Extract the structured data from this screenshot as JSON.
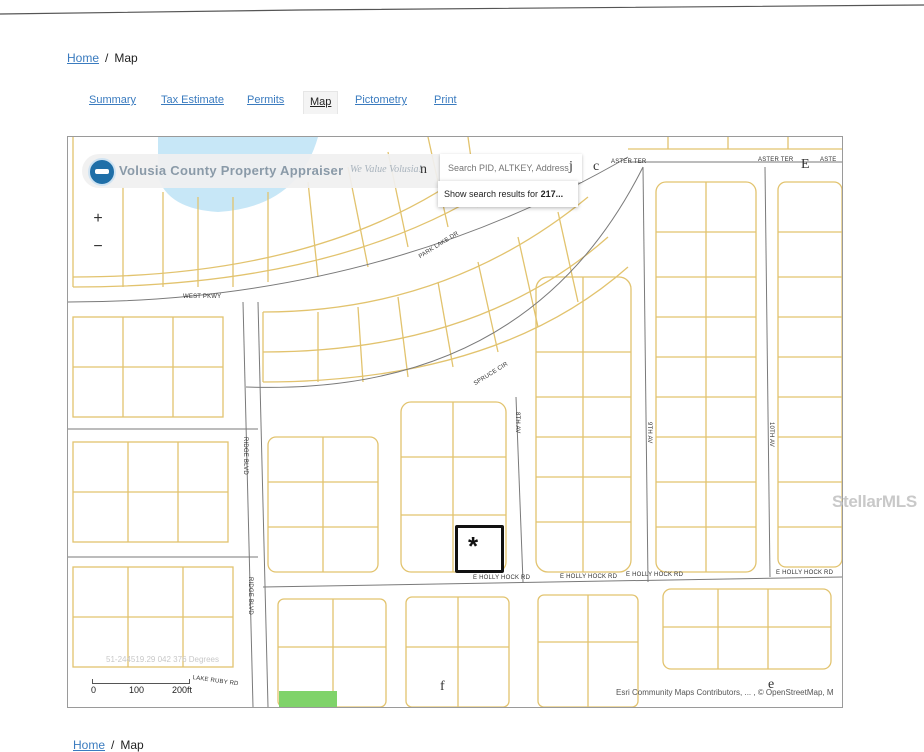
{
  "breadcrumb": {
    "home": "Home",
    "separator": "/",
    "current": "Map"
  },
  "tabs": [
    {
      "label": "Summary",
      "active": false
    },
    {
      "label": "Tax Estimate",
      "active": false
    },
    {
      "label": "Permits",
      "active": false
    },
    {
      "label": "Map",
      "active": true
    },
    {
      "label": "Pictometry",
      "active": false
    },
    {
      "label": "Print",
      "active": false
    }
  ],
  "map": {
    "org_name": "Volusia County Property Appraiser",
    "tagline": "We Value Volusia!",
    "search": {
      "placeholder": "Search PID, ALTKEY, Address"
    },
    "search_glyphs": {
      "a": "n",
      "b": "j",
      "c": "c",
      "d": "E"
    },
    "suggestion": {
      "prefix": "Show search results for",
      "query": "217..."
    },
    "zoom_in": "+",
    "zoom_out": "−",
    "streets": {
      "park_lake": "PARK LAKE DR",
      "west_pkwy": "WEST PKWY",
      "spruce": "SPRUCE CIR",
      "ridge_1": "RIDGE BLVD",
      "ridge_2": "RIDGE BLVD",
      "eighth": "8TH AV",
      "ninth": "9TH AV",
      "tenth": "10TH AV",
      "aster_1": "ASTER TER",
      "aster_2": "ASTER TER",
      "aster_3": "ASTE",
      "hollyhock_1": "E HOLLY HOCK RD",
      "hollyhock_2": "E HOLLY HOCK RD",
      "hollyhock_3": "E HOLLY HOCK RD",
      "hollyhock_4": "E HOLLY HOCK RD",
      "lake_ruby": "LAKE RUBY RD"
    },
    "coordinates": "51-244519.29 042 376 Degrees",
    "scale": {
      "zero": "0",
      "mid": "100",
      "end": "200ft"
    },
    "bottom_glyphs": {
      "f": "f",
      "e": "e"
    },
    "attribution": "Esri Community Maps Contributors, ... , © OpenStreetMap, M",
    "marker_symbol": "*"
  },
  "watermark": "StellarMLS",
  "colors": {
    "parcel": "#e2c36e",
    "road": "#7a7a7a",
    "link": "#3a7bbf",
    "water": "#c7e7f7",
    "highlight": "#7fd36a"
  }
}
